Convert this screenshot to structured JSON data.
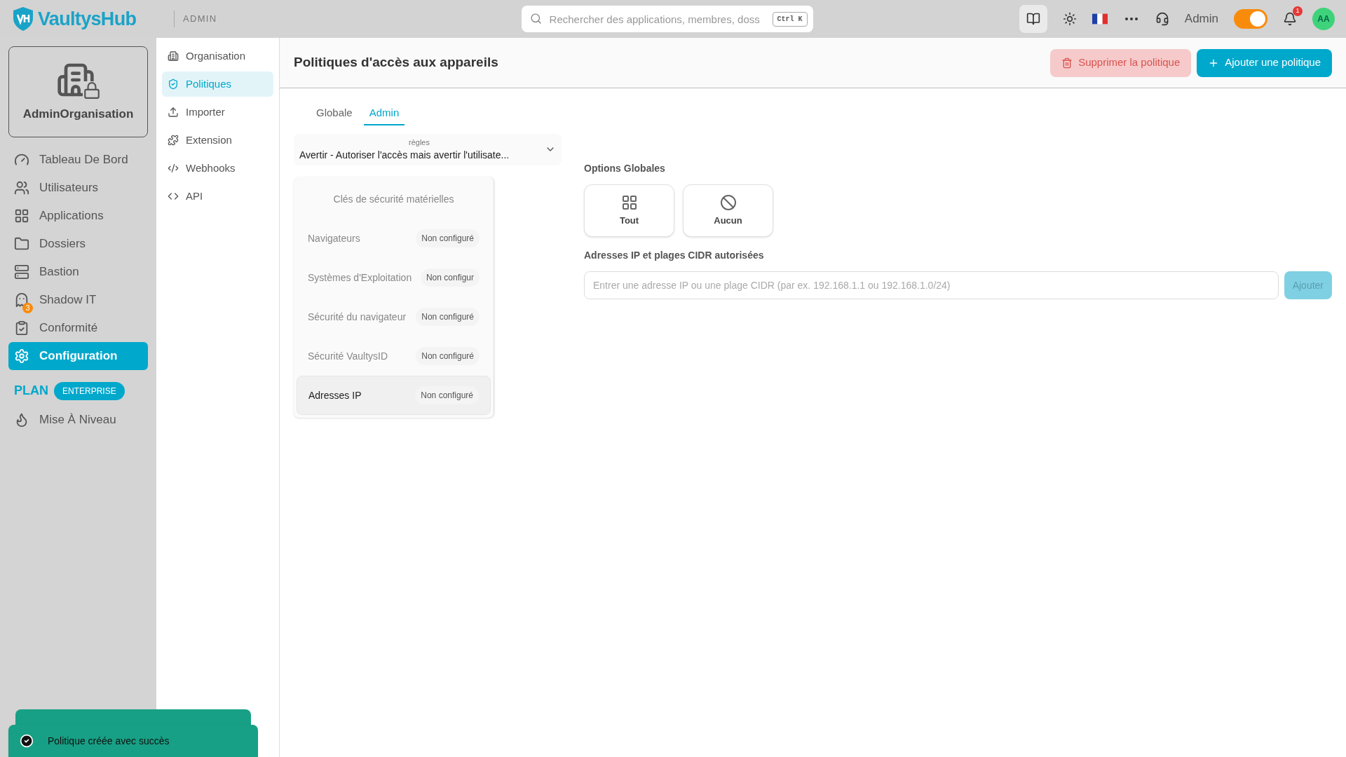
{
  "topbar": {
    "brand": "VaultysHub",
    "section": "ADMIN",
    "search": {
      "placeholder": "Rechercher des applications, membres, doss",
      "shortcut": "Ctrl K"
    },
    "user_label": "Admin",
    "mode_toggle": {
      "on": true
    },
    "notifications": {
      "count": "1"
    },
    "avatar": "AA"
  },
  "org": {
    "name": "AdminOrganisation"
  },
  "sidebar": {
    "items": [
      {
        "label": "Tableau De Bord",
        "kind": "gauge",
        "selected": false
      },
      {
        "label": "Utilisateurs",
        "kind": "users",
        "selected": false
      },
      {
        "label": "Applications",
        "kind": "grid",
        "selected": false
      },
      {
        "label": "Dossiers",
        "kind": "folder",
        "selected": false
      },
      {
        "label": "Bastion",
        "kind": "server",
        "selected": false
      },
      {
        "label": "Shadow IT",
        "kind": "ghost",
        "selected": false,
        "badge": "3"
      },
      {
        "label": "Conformité",
        "kind": "clipboard",
        "selected": false
      },
      {
        "label": "Configuration",
        "kind": "gear",
        "selected": true
      }
    ],
    "plan": {
      "label": "PLAN",
      "tier": "ENTERPRISE"
    },
    "upgrade": {
      "label": "Mise À Niveau"
    }
  },
  "subnav": {
    "items": [
      {
        "label": "Organisation",
        "kind": "building",
        "selected": false
      },
      {
        "label": "Politiques",
        "kind": "shield",
        "selected": true
      },
      {
        "label": "Importer",
        "kind": "upload",
        "selected": false
      },
      {
        "label": "Extension",
        "kind": "puzzle",
        "selected": false
      },
      {
        "label": "Webhooks",
        "kind": "webhook",
        "selected": false
      },
      {
        "label": "API",
        "kind": "code",
        "selected": false
      }
    ]
  },
  "page": {
    "title": "Politiques d'accès aux appareils",
    "delete_button": "Supprimer la politique",
    "add_button": "Ajouter une politique"
  },
  "tabs": [
    {
      "label": "Globale",
      "selected": false
    },
    {
      "label": "Admin",
      "selected": true
    }
  ],
  "rule_select": {
    "label": "règles",
    "value": "Avertir - Autoriser l'accès mais avertir l'utilisate..."
  },
  "categories": [
    {
      "label": "Clés de sécurité matérielles",
      "selected": false
    },
    {
      "label": "Navigateurs",
      "status": "Non configuré",
      "selected": false
    },
    {
      "label": "Systèmes d'Exploitation",
      "status": "Non configur",
      "selected": false
    },
    {
      "label": "Sécurité du navigateur",
      "status": "Non configuré",
      "selected": false
    },
    {
      "label": "Sécurité VaultysID",
      "status": "Non configuré",
      "selected": false
    },
    {
      "label": "Adresses IP",
      "status": "Non configuré",
      "selected": true
    }
  ],
  "global_options": {
    "title": "Options Globales",
    "options": [
      {
        "label": "Tout",
        "kind": "grid"
      },
      {
        "label": "Aucun",
        "kind": "none"
      }
    ]
  },
  "ip_section": {
    "title": "Adresses IP et plages CIDR autorisées",
    "placeholder": "Entrer une adresse IP ou une plage CIDR (par ex. 192.168.1.1 ou 192.168.1.0/24)",
    "button": "Ajouter",
    "button_disabled": true
  },
  "toasts": [
    {
      "kind": "hidden"
    },
    {
      "kind": "success",
      "message": "Politique créée avec succès"
    }
  ]
}
